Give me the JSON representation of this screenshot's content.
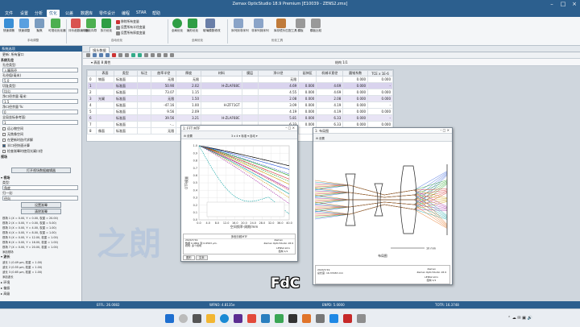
{
  "window": {
    "title": "Zemax OpticStudio 18.9   Premium   [E10039 - ZENS2.zmx]"
  },
  "menu": [
    "文件",
    "设置",
    "分析",
    "优化",
    "公差",
    "数据库",
    "零件设计",
    "编程",
    "STAR",
    "帮助"
  ],
  "menu_active": 3,
  "ribbon": {
    "buttons": [
      "快速调焦",
      "快速调整",
      "聚焦",
      "可视化优化器",
      "评价函数编辑器",
      "优化向导",
      "执行优化",
      "全局优化",
      "锤形优化",
      "玻璃模数修改",
      "序列到非序列",
      "非序列到序列",
      "库存镜头匹配工具",
      "模板",
      "模板比较"
    ],
    "small": [
      "移除所有变量",
      "设置所有半径变量",
      "设置所有厚度变量"
    ],
    "groups": [
      "手动调整",
      "自动优化",
      "全局优化",
      "优化工具"
    ]
  },
  "left_panel": {
    "title": "系统选项",
    "update": "更新: 所有窗口",
    "aperture_section": "系统孔径",
    "aperture_type_label": "孔径类型:",
    "aperture_type_value": "入瞳直径",
    "aperture_value_label": "孔径值(毫米)",
    "aperture_value": "5.0",
    "pupil_label": "切趾类型:",
    "pupil_value": "均匀",
    "clear_label": "净口径余量 毫米:",
    "clear_value": "1.5",
    "clear_pct_label": "净口径余量 %:",
    "clear_pct_value": "0",
    "global_ref_label": "全局坐标参考面:",
    "global_ref_value": "1",
    "checks": [
      "远心物空间",
      "无焦像空间",
      "在更新时迭代求解",
      "半口径快速计算",
      "检查渐晕时使用光阑口径"
    ],
    "checks_on": [
      false,
      false,
      false,
      true,
      false
    ],
    "open_aperture_btn": "打开视场数据编辑器",
    "field_section": "视场",
    "field_type_label": "类型:",
    "field_type_value": "角度",
    "normalize_label": "归一化:",
    "normalize_value": "径向",
    "set_vignetting": "设置渐晕",
    "clear_vignetting": "清除渐晕",
    "fields": [
      "视场 1 (X = 0.00, Y = 0.00, 权重 = 20.00)",
      "视场 2 (X = 0.00, Y = 0.00, 权重 = 5.00)",
      "视场 3 (X = 0.00, Y = 4.00, 权重 = 1.00)",
      "视场 4 (X = 0.00, Y = 8.00, 权重 = 1.00)",
      "视场 5 (X = 0.00, Y = 12.00, 权重 = 1.00)",
      "视场 6 (X = 0.00, Y = 16.00, 权重 = 1.00)",
      "视场 7 (X = 0.00, Y = 20.00, 权重 = 1.00)",
      "添加视场"
    ],
    "wave_section": "波长",
    "waves": [
      "波长 1 (0.49 μm, 权重 = 1.00)",
      "波长 2 (0.55 μm, 权重 = 1.00)",
      "波长 3 (0.65 μm, 权重 = 1.00)",
      "添加波长"
    ],
    "env": "环境",
    "poly": "偏振",
    "advanced": "高级"
  },
  "tabs": [
    "镜头数据"
  ],
  "lde": {
    "surface_label": "表面",
    "surface_value": "8 属性",
    "config_label": "结构 1/1",
    "headers": [
      "",
      "表面",
      "类型",
      "标注",
      "曲率半径",
      "",
      "厚度",
      "",
      "材料",
      "",
      "膜层",
      "",
      "净口径",
      "",
      "延伸区",
      "",
      "机械半直径",
      "",
      "圆锥系数",
      "",
      "TCE x 1E-6"
    ],
    "rows": [
      {
        "n": "0",
        "name": "物面",
        "type": "标准面",
        "r": "无限",
        "t": "无限",
        "m": "",
        "c": "无限",
        "e": "",
        "mech": "",
        "k": "0.000",
        "tce": "0.000"
      },
      {
        "n": "1",
        "name": "",
        "type": "标准面",
        "r": "50.90",
        "t": "2.02",
        "m": "H-ZLAF68C",
        "c": "4.69",
        "e": "0.000",
        "mech": "4.69",
        "k": "0.000",
        "tce": "-"
      },
      {
        "n": "2",
        "name": "",
        "type": "标准面",
        "r": "73.07",
        "t": "1.15",
        "m": "",
        "c": "4.55",
        "e": "0.000",
        "mech": "4.69",
        "k": "0.000",
        "tce": "0.000"
      },
      {
        "n": "3",
        "name": "光阑",
        "type": "标准面",
        "r": "无限",
        "t": "1.50",
        "m": "",
        "c": "2.08",
        "e": "0.000",
        "mech": "2.08",
        "k": "0.000",
        "tce": "0.000"
      },
      {
        "n": "4",
        "name": "",
        "type": "标准面",
        "r": "-47.16",
        "t": "1.00",
        "m": "H-ZF71GT",
        "c": "3.09",
        "e": "0.000",
        "mech": "4.19",
        "k": "0.000",
        "tce": "-"
      },
      {
        "n": "5",
        "name": "",
        "type": "标准面",
        "r": "9.56",
        "t": "2.09",
        "m": "",
        "c": "4.19",
        "e": "0.000",
        "mech": "4.19",
        "k": "0.000",
        "tce": "0.000"
      },
      {
        "n": "6",
        "name": "",
        "type": "标准面",
        "r": "39.56",
        "t": "3.21",
        "m": "H-ZLAF68C",
        "c": "5.81",
        "e": "0.000",
        "mech": "6.33",
        "k": "0.000",
        "tce": "-"
      },
      {
        "n": "7",
        "name": "",
        "type": "标准面",
        "r": "-...",
        "t": "...",
        "m": "",
        "c": "6.33",
        "e": "0.000",
        "mech": "6.33",
        "k": "0.000",
        "tce": "0.000"
      },
      {
        "n": "8",
        "name": "像面",
        "type": "标准面",
        "r": "无限",
        "t": "-",
        "m": "",
        "c": "",
        "e": "",
        "mech": "",
        "k": "0.000",
        "tce": "0.000"
      }
    ]
  },
  "mtf": {
    "title": "1: FFT MTF",
    "toolbar_text": "3 x 4 ▾   标准 ▾   自动 ▾",
    "settings": "设置",
    "ylabel": "OTF模量",
    "xlabel": "空间频率-周期/mm",
    "yticks": [
      "1.0",
      "0.9",
      "0.8",
      "0.7",
      "0.6",
      "0.5",
      "0.4",
      "0.3",
      "0.2",
      "0.1",
      "0.0"
    ],
    "xticks": [
      "0.0",
      "4.0",
      "8.0",
      "12.0",
      "16.0",
      "20.0",
      "24.0",
      "28.0",
      "32.0",
      "36.0",
      "40.0"
    ],
    "footer_title": "多色衍射MTF",
    "footer_text": "2024/7/19\n数据 0.4861 到 0.6563 μm.\n视场: 多个视场",
    "footer_right": "Zemax\nZemax OpticStudio 18.9",
    "footer_file": "LENS2.zmx\n结构 1/1",
    "tabs": [
      "图形",
      "文本"
    ]
  },
  "layout": {
    "title": "1: 布局图",
    "settings": "设置",
    "scale": "10 mm",
    "label": "布局图",
    "footer_right": "Zemax\nZemax OpticStudio 18.9",
    "footer_left": "2024/7/19\n总长度: 16.37483 mm",
    "footer_file": "LENS2.zmx\n结构 1/1"
  },
  "status": [
    "EFFL: 26.0082",
    "WFNO: 4.8135e",
    "ENPD: 5.0000",
    "TOTR: 16.3748"
  ],
  "caption": "FdC",
  "watermark": "之朗"
}
